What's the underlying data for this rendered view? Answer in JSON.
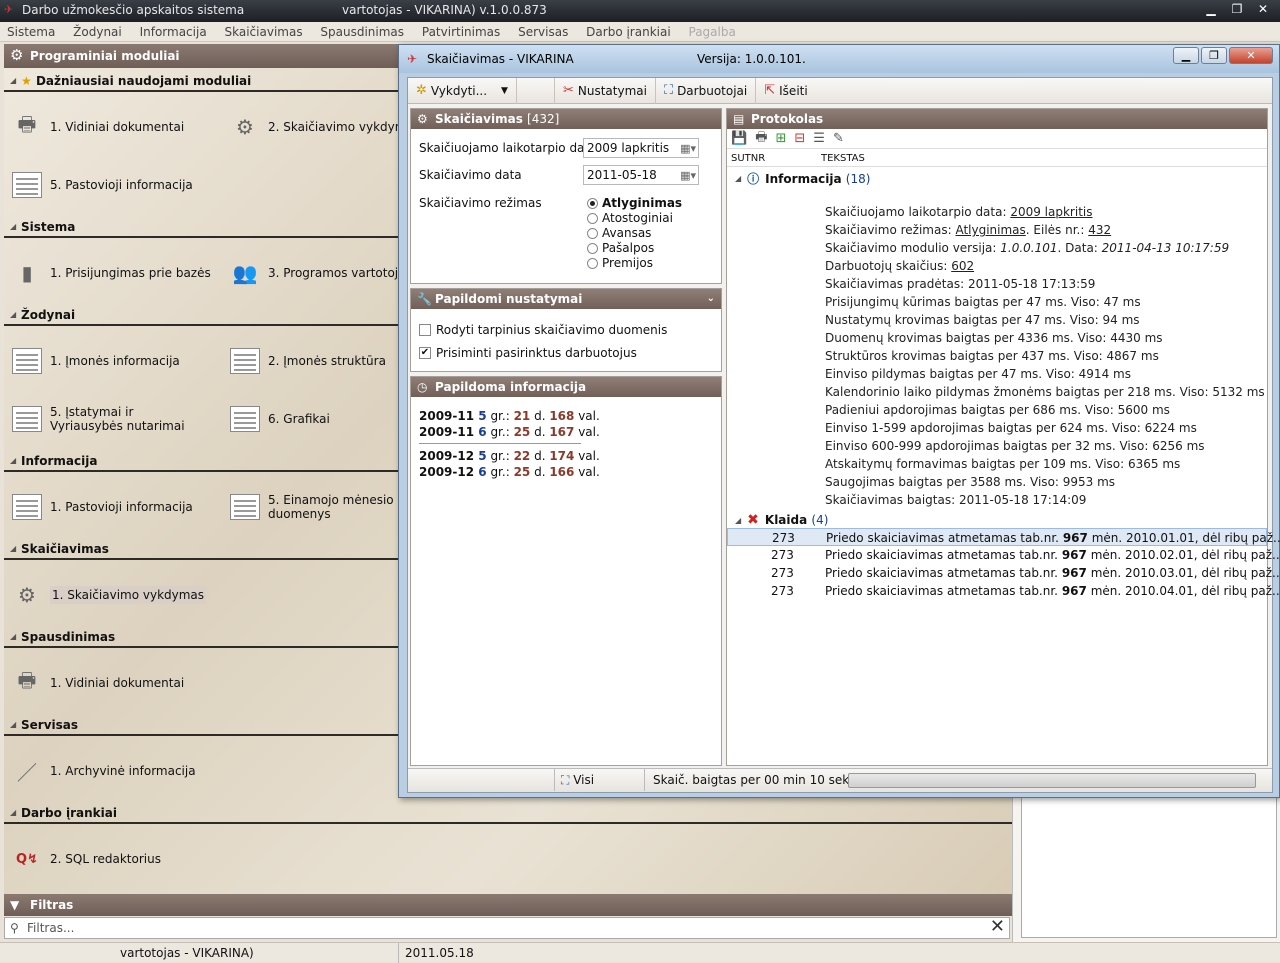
{
  "app": {
    "title": "Darbo užmokesčio apskaitos sistema",
    "title_user": "vartotojas - VIKARINA) v.1.0.0.873",
    "menu": [
      "Sistema",
      "Žodynai",
      "Informacija",
      "Skaičiavimas",
      "Spausdinimas",
      "Patvirtinimas",
      "Servisas",
      "Darbo įrankiai",
      "Pagalba"
    ]
  },
  "left": {
    "header": "Programiniai moduliai",
    "sections": {
      "favorites": "Dažniausiai naudojami moduliai",
      "sistema": "Sistema",
      "zodynai": "Žodynai",
      "informacija": "Informacija",
      "skaiciavimas": "Skaičiavimas",
      "spausdinimas": "Spausdinimas",
      "servisas": "Servisas",
      "darbo_irankiai": "Darbo įrankiai"
    },
    "modules": {
      "fav1": "1. Vidiniai dokumentai",
      "fav2": "2. Skaičiavimo vykdymas",
      "fav3": "5. Pastovioji informacija",
      "sys1": "1. Prisijungimas prie bazės",
      "sys2": "3. Programos vartotojai",
      "zod1": "1. Įmonės informacija",
      "zod2": "2. Įmonės struktūra",
      "zod3": "5. Įstatymai ir Vyriausybės nutarimai",
      "zod4": "6. Grafikai",
      "inf1": "1. Pastovioji informacija",
      "inf2": "5. Einamojo mėnesio duomenys",
      "sk1": "1. Skaičiavimo vykdymas",
      "sp1": "1. Vidiniai dokumentai",
      "se1": "1. Archyvinė informacija",
      "di1": "2. SQL redaktorius"
    },
    "filter_header": "Filtras",
    "filter_placeholder": "Filtras..."
  },
  "status": {
    "user": "vartotojas - VIKARINA)",
    "date": "2011.05.18"
  },
  "dialog": {
    "title": "Skaičiavimas - VIKARINA",
    "version": "Versija: 1.0.0.101.",
    "toolbar": {
      "run": "Vykdyti...",
      "settings": "Nustatymai",
      "employees": "Darbuotojai",
      "exit": "Išeiti"
    },
    "calc": {
      "header": "Skaičiavimas",
      "count": "[432]",
      "period_label": "Skaičiuojamo laikotarpio data",
      "period_value": "2009  lapkritis",
      "date_label": "Skaičiavimo data",
      "date_value": "2011-05-18",
      "mode_label": "Skaičiavimo režimas",
      "modes": [
        "Atlyginimas",
        "Atostoginiai",
        "Avansas",
        "Pašalpos",
        "Premijos"
      ]
    },
    "extra": {
      "header": "Papildomi nustatymai",
      "opt1": "Rodyti tarpinius skaičiavimo duomenis",
      "opt2": "Prisiminti pasirinktus darbuotojus"
    },
    "info": {
      "header": "Papildoma informacija",
      "lines": [
        {
          "period": "2009-11",
          "d": "5",
          "gr": " gr.: ",
          "days": "21",
          "dlbl": " d. ",
          "hours": "168",
          "unit": " val."
        },
        {
          "period": "2009-11",
          "d": "6",
          "gr": " gr.: ",
          "days": "25",
          "dlbl": " d. ",
          "hours": "167",
          "unit": " val."
        },
        {
          "period": "2009-12",
          "d": "5",
          "gr": " gr.: ",
          "days": "22",
          "dlbl": " d. ",
          "hours": "174",
          "unit": " val."
        },
        {
          "period": "2009-12",
          "d": "6",
          "gr": " gr.: ",
          "days": "25",
          "dlbl": " d. ",
          "hours": "166",
          "unit": " val."
        }
      ]
    },
    "protocol": {
      "header": "Protokolas",
      "col1": "SUTNR",
      "col2": "TEKSTAS",
      "info_group": "Informacija",
      "info_count": "(18)",
      "error_group": "Klaida",
      "error_count": "(4)",
      "logs": [
        "Skaičiuojamo laikotarpio data: 2009 lapkritis",
        "Skaičiavimo režimas: Atlyginimas. Eilės nr.: 432",
        "Skaičiavimo modulio versija: 1.0.0.101. Data: 2011-04-13 10:17:59",
        "Darbuotojų skaičius: 602",
        "Skaičiavimas pradėtas: 2011-05-18 17:13:59",
        "Prisijungimų kūrimas baigtas per 47 ms. Viso: 47 ms",
        "Nustatymų krovimas baigtas per 47 ms. Viso: 94 ms",
        "Duomenų krovimas baigtas per 4336 ms. Viso: 4430 ms",
        "Struktūros krovimas baigtas per 437 ms. Viso: 4867 ms",
        "Einviso pildymas baigtas per 47 ms. Viso: 4914 ms",
        "Kalendorinio laiko pildymas žmonėms baigtas per 218 ms. Viso: 5132 ms",
        "Padieniui apdorojimas baigtas per 686 ms. Viso: 5600 ms",
        "Einviso 1-599 apdorojimas baigtas per 624 ms. Viso: 6224 ms",
        "Einviso 600-999 apdorojimas baigtas per 32 ms. Viso: 6256 ms",
        "Atskaitymų formavimas baigtas per 109 ms. Viso: 6365 ms",
        "Saugojimas baigtas per 3588 ms. Viso: 9953 ms",
        "Skaičiavimas baigtas: 2011-05-18 17:14:09"
      ],
      "errors": [
        {
          "sutnr": "273",
          "pre": "Priedo skaiciavimas atmetamas tab.nr. ",
          "tab": "967",
          "post": " mėn. 2010.01.01, dėl ribų paž..."
        },
        {
          "sutnr": "273",
          "pre": "Priedo skaiciavimas atmetamas tab.nr. ",
          "tab": "967",
          "post": " mėn. 2010.02.01, dėl ribų paž..."
        },
        {
          "sutnr": "273",
          "pre": "Priedo skaiciavimas atmetamas tab.nr. ",
          "tab": "967",
          "post": " mėn. 2010.03.01, dėl ribų paž..."
        },
        {
          "sutnr": "273",
          "pre": "Priedo skaiciavimas atmetamas tab.nr. ",
          "tab": "967",
          "post": " mėn. 2010.04.01, dėl ribų paž..."
        }
      ]
    },
    "statusbar": {
      "filter": "Visi",
      "elapsed": "Skaič. baigtas per  00 min 10 sek"
    }
  }
}
